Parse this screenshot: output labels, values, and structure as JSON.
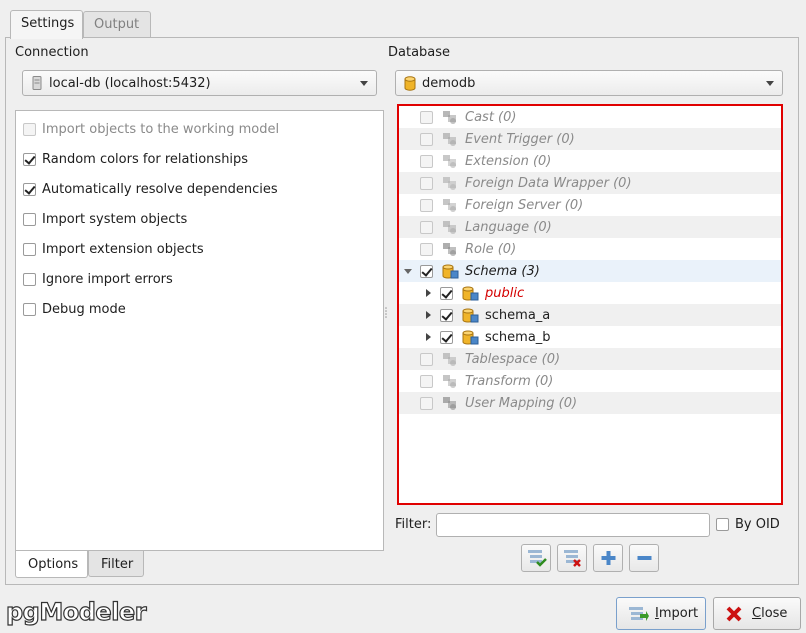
{
  "tabs": [
    "Settings",
    "Output"
  ],
  "connection": {
    "label": "Connection",
    "selected": "local-db (localhost:5432)"
  },
  "options": [
    {
      "label": "Import objects to the working model",
      "checked": false,
      "enabled": false
    },
    {
      "label": "Random colors for relationships",
      "checked": true,
      "enabled": true
    },
    {
      "label": "Automatically resolve dependencies",
      "checked": true,
      "enabled": true
    },
    {
      "label": "Import system objects",
      "checked": false,
      "enabled": true
    },
    {
      "label": "Import extension objects",
      "checked": false,
      "enabled": true
    },
    {
      "label": "Ignore import errors",
      "checked": false,
      "enabled": true
    },
    {
      "label": "Debug mode",
      "checked": false,
      "enabled": true
    }
  ],
  "bottom_tabs": [
    "Options",
    "Filter"
  ],
  "database": {
    "label": "Database",
    "selected": "demodb"
  },
  "tree": [
    {
      "name": "Cast (0)",
      "checked": false,
      "disabled": true
    },
    {
      "name": "Event Trigger (0)",
      "checked": false,
      "disabled": true
    },
    {
      "name": "Extension (0)",
      "checked": false,
      "disabled": true
    },
    {
      "name": "Foreign Data Wrapper (0)",
      "checked": false,
      "disabled": true
    },
    {
      "name": "Foreign Server (0)",
      "checked": false,
      "disabled": true
    },
    {
      "name": "Language (0)",
      "checked": false,
      "disabled": true
    },
    {
      "name": "Role (0)",
      "checked": false,
      "disabled": true
    },
    {
      "name": "Schema (3)",
      "checked": true,
      "disabled": false,
      "expanded": true
    },
    {
      "name": "public",
      "checked": true,
      "disabled": false,
      "child": true,
      "highlight": true
    },
    {
      "name": "schema_a",
      "checked": true,
      "disabled": false,
      "child": true
    },
    {
      "name": "schema_b",
      "checked": true,
      "disabled": false,
      "child": true
    },
    {
      "name": "Tablespace (0)",
      "checked": false,
      "disabled": true
    },
    {
      "name": "Transform (0)",
      "checked": false,
      "disabled": true
    },
    {
      "name": "User Mapping (0)",
      "checked": false,
      "disabled": true
    }
  ],
  "filter": {
    "label": "Filter:",
    "value": "",
    "by_oid_label": "By OID",
    "by_oid_checked": false
  },
  "logo": "pgModeler",
  "buttons": {
    "import_label": "Import",
    "close_label": "Close"
  },
  "colors": {
    "highlight_border": "#e00000",
    "public_schema": "#d40000"
  }
}
